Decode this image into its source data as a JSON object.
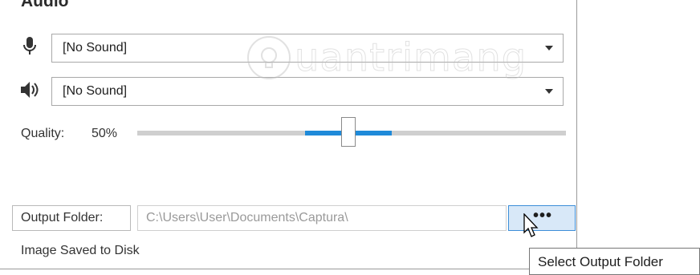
{
  "audio": {
    "title": "Audio",
    "microphone": {
      "icon": "microphone-icon",
      "value": "[No Sound]"
    },
    "speaker": {
      "icon": "speaker-icon",
      "value": "[No Sound]"
    }
  },
  "quality": {
    "label": "Quality:",
    "value_text": "50%",
    "value": 50
  },
  "output": {
    "label": "Output Folder:",
    "path": "C:\\Users\\User\\Documents\\Captura\\",
    "browse_label": "•••"
  },
  "status": {
    "text": "Image Saved to Disk"
  },
  "tooltip": {
    "text": "Select Output Folder"
  },
  "watermark": {
    "text": "uantrimang"
  },
  "colors": {
    "accent": "#1f8ad9",
    "track": "#cfcfcf",
    "button_bg": "#d8e8f8",
    "button_border": "#3c8ed8"
  }
}
